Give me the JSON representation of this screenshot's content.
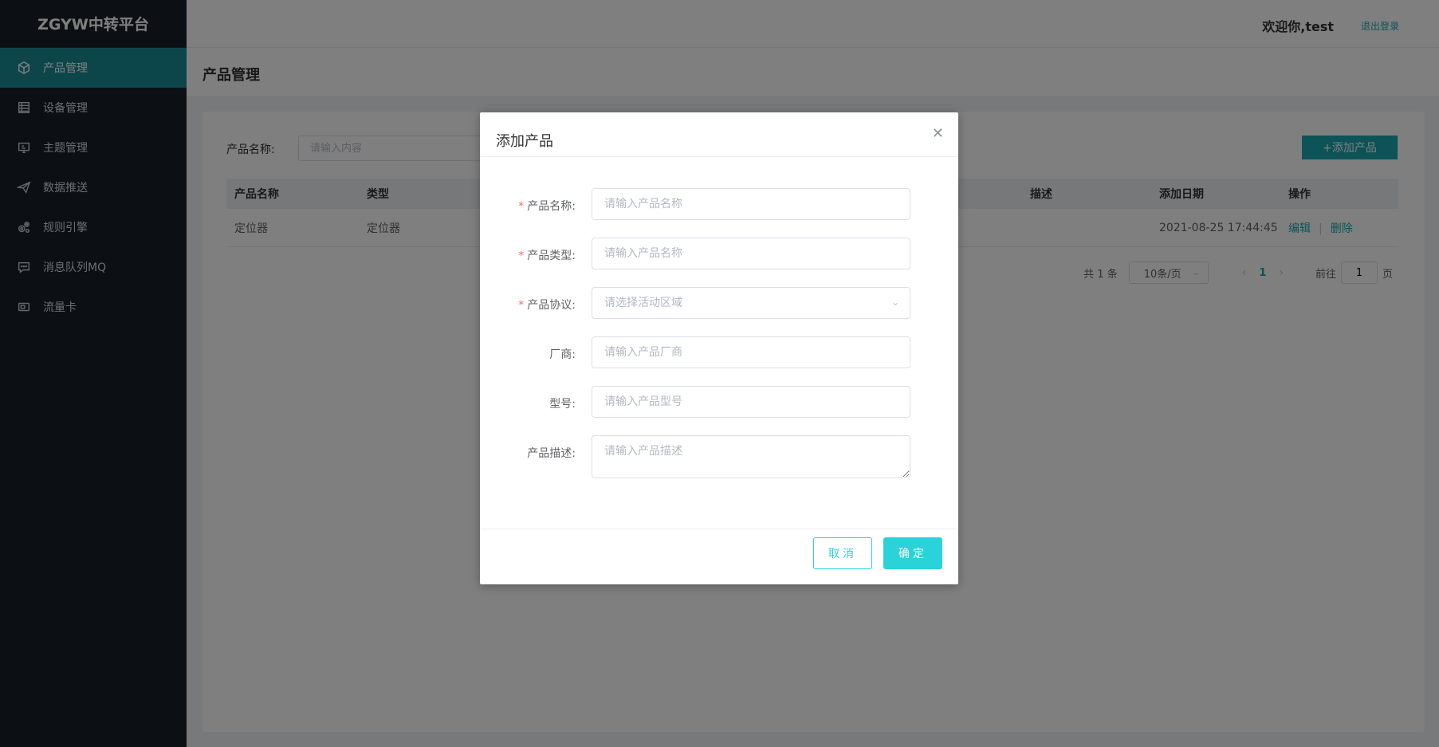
{
  "app": {
    "title": "ZGYW中转平台"
  },
  "sidebar": {
    "items": [
      {
        "label": "产品管理",
        "icon": "cube-icon",
        "active": true
      },
      {
        "label": "设备管理",
        "icon": "table-icon",
        "active": false
      },
      {
        "label": "主题管理",
        "icon": "monitor-icon",
        "active": false
      },
      {
        "label": "数据推送",
        "icon": "send-icon",
        "active": false
      },
      {
        "label": "规则引擎",
        "icon": "gears-icon",
        "active": false
      },
      {
        "label": "消息队列MQ",
        "icon": "chat-icon",
        "active": false
      },
      {
        "label": "流量卡",
        "icon": "card-icon",
        "active": false
      }
    ]
  },
  "header": {
    "welcome": "欢迎你,test",
    "logout": "退出登录"
  },
  "page": {
    "title": "产品管理"
  },
  "filter": {
    "label": "产品名称:",
    "placeholder": "请输入内容",
    "add_button": "+添加产品"
  },
  "table": {
    "headers": {
      "name": "产品名称",
      "type": "类型",
      "desc": "描述",
      "date": "添加日期",
      "ops": "操作"
    },
    "rows": [
      {
        "name": "定位器",
        "type": "定位器",
        "date": "2021-08-25 17:44:45",
        "edit": "编辑",
        "delete": "删除"
      }
    ]
  },
  "pagination": {
    "total": "共 1 条",
    "page_size": "10条/页",
    "current": "1",
    "goto_label": "前往",
    "goto_value": "1",
    "page_suffix": "页"
  },
  "dialog": {
    "title": "添加产品",
    "fields": {
      "name": {
        "label": "产品名称:",
        "placeholder": "请输入产品名称",
        "required": true
      },
      "type": {
        "label": "产品类型:",
        "placeholder": "请输入产品名称",
        "required": true
      },
      "protocol": {
        "label": "产品协议:",
        "placeholder": "请选择活动区域",
        "required": true
      },
      "vendor": {
        "label": "厂商:",
        "placeholder": "请输入产品厂商",
        "required": false
      },
      "model": {
        "label": "型号:",
        "placeholder": "请输入产品型号",
        "required": false
      },
      "desc": {
        "label": "产品描述:",
        "placeholder": "请输入产品描述",
        "required": false
      }
    },
    "cancel": "取消",
    "confirm": "确定"
  },
  "colors": {
    "sidebar_bg": "#19202b",
    "accent": "#1aa6b0",
    "dialog_button": "#2ad3d9",
    "required": "#f56c6c"
  }
}
